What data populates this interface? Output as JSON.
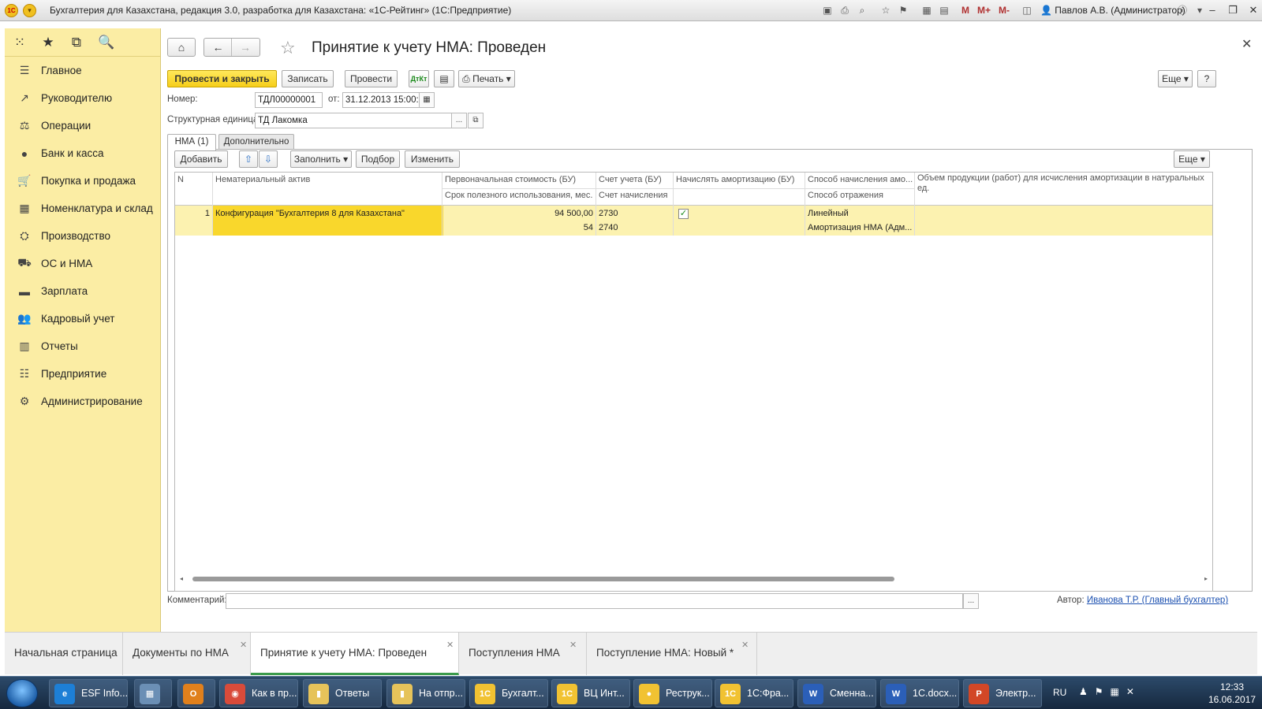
{
  "window": {
    "title": "Бухгалтерия для Казахстана, редакция 3.0, разработка для Казахстана: «1С-Рейтинг» (1С:Предприятие)",
    "user": "Павлов А.В. (Администратор)",
    "toolbar_m": "M",
    "toolbar_mplus": "M+",
    "toolbar_mminus": "M-"
  },
  "sidebar": {
    "items": [
      {
        "label": "Главное",
        "icon": "menu-lines-icon"
      },
      {
        "label": "Руководителю",
        "icon": "trend-icon"
      },
      {
        "label": "Операции",
        "icon": "operations-icon"
      },
      {
        "label": "Банк и касса",
        "icon": "bank-icon"
      },
      {
        "label": "Покупка и продажа",
        "icon": "cart-icon"
      },
      {
        "label": "Номенклатура и склад",
        "icon": "grid-icon"
      },
      {
        "label": "Производство",
        "icon": "factory-icon"
      },
      {
        "label": "ОС и НМА",
        "icon": "truck-icon"
      },
      {
        "label": "Зарплата",
        "icon": "wallet-icon"
      },
      {
        "label": "Кадровый учет",
        "icon": "people-icon"
      },
      {
        "label": "Отчеты",
        "icon": "bar-chart-icon"
      },
      {
        "label": "Предприятие",
        "icon": "list-icon"
      },
      {
        "label": "Администрирование",
        "icon": "gear-icon"
      }
    ]
  },
  "document": {
    "title": "Принятие к учету НМА: Проведен",
    "buttons": {
      "post_close": "Провести и закрыть",
      "save": "Записать",
      "post": "Провести",
      "print": "Печать",
      "more": "Еще",
      "help": "?"
    },
    "number_label": "Номер:",
    "number_value": "ТДЛ00000001",
    "date_label": "от:",
    "date_value": "31.12.2013 15:00:0",
    "unit_label": "Структурная единица:",
    "unit_value": "ТД Лакомка",
    "unit_select": "...",
    "tabs": [
      "НМА (1)",
      "Дополнительно"
    ],
    "table_toolbar": {
      "add": "Добавить",
      "fill": "Заполнить",
      "pick": "Подбор",
      "change": "Изменить",
      "more": "Еще"
    },
    "columns": {
      "n": "N",
      "asset": "Нематериальный актив",
      "cost": "Первоначальная стоимость (БУ)",
      "life": "Срок полезного использования, мес.",
      "account": "Счет учета (БУ)",
      "accrual_account": "Счет начисления",
      "amortize": "Начислять амортизацию (БУ)",
      "method": "Способ начисления амо...",
      "reflection": "Способ отражения",
      "volume": "Объем продукции (работ) для исчисления амортизации в натуральных ед."
    },
    "rows": [
      {
        "n": "1",
        "asset": "Конфигурация \"Бухгалтерия 8 для Казахстана\"",
        "cost": "94 500,00",
        "life": "54",
        "account": "2730",
        "accrual_account": "2740",
        "amortize": true,
        "method": "Линейный",
        "reflection": "Амортизация НМА (Адм..."
      }
    ],
    "comment_label": "Комментарий:",
    "comment_value": "",
    "comment_select": "...",
    "author_label": "Автор:",
    "author_value": "Иванова Т.Р. (Главный бухгалтер)"
  },
  "open_windows": [
    {
      "label": "Начальная страница",
      "closable": false,
      "active": false
    },
    {
      "label": "Документы по НМА",
      "closable": true,
      "active": false
    },
    {
      "label": "Принятие к учету НМА: Проведен",
      "closable": true,
      "active": true
    },
    {
      "label": "Поступления НМА",
      "closable": true,
      "active": false
    },
    {
      "label": "Поступление НМА: Новый *",
      "closable": true,
      "active": false
    }
  ],
  "taskbar": {
    "tasks": [
      {
        "label": "ESF Info...",
        "icon_text": "e",
        "color": "#1d7fd6"
      },
      {
        "label": "",
        "icon_text": "▦",
        "color": "#6b8fb5"
      },
      {
        "label": "",
        "icon_text": "O",
        "color": "#e0801c"
      },
      {
        "label": "Как в пр...",
        "icon_text": "◉",
        "color": "#d94b3a"
      },
      {
        "label": "Ответы",
        "icon_text": "▮",
        "color": "#e6c35a"
      },
      {
        "label": "На отпр...",
        "icon_text": "▮",
        "color": "#e6c35a"
      },
      {
        "label": "Бухгалт...",
        "icon_text": "1C",
        "color": "#f1c232"
      },
      {
        "label": "ВЦ Инт...",
        "icon_text": "1C",
        "color": "#f1c232"
      },
      {
        "label": "Реструк...",
        "icon_text": "●",
        "color": "#f1c232"
      },
      {
        "label": "1С:Фра...",
        "icon_text": "1C",
        "color": "#f1c232"
      },
      {
        "label": "Сменна...",
        "icon_text": "W",
        "color": "#2b5fb8"
      },
      {
        "label": "1C.docx...",
        "icon_text": "W",
        "color": "#2b5fb8"
      },
      {
        "label": "Электр...",
        "icon_text": "P",
        "color": "#d24726"
      }
    ],
    "lang": "RU",
    "time": "12:33",
    "date": "16.06.2017"
  }
}
